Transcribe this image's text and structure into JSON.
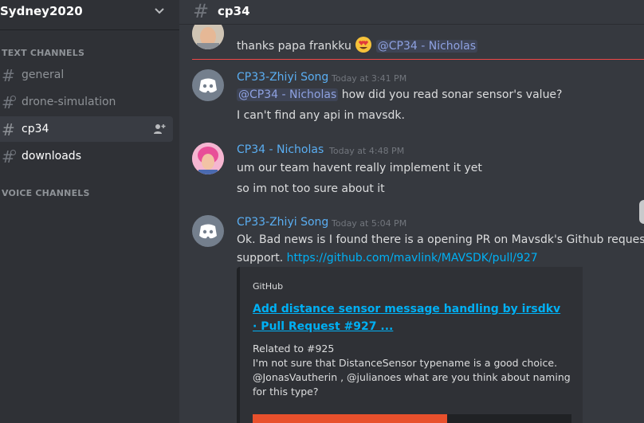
{
  "server": {
    "name": "Sydney2020"
  },
  "categories": {
    "text": "TEXT CHANNELS",
    "voice": "VOICE CHANNELS"
  },
  "channels": [
    {
      "name": "general"
    },
    {
      "name": "drone-simulation"
    },
    {
      "name": "cp34"
    },
    {
      "name": "downloads"
    }
  ],
  "topbar": {
    "channel": "cp34"
  },
  "messages": [
    {
      "text": "thanks papa frankku",
      "mention": "@CP34 - Nicholas"
    },
    {
      "author": "CP33-Zhiyi Song",
      "time": "Today at 3:41 PM",
      "mention": "@CP34 - Nicholas",
      "line1_rest": " how did you read sonar sensor's value?",
      "line2": "I can't find any api in mavsdk."
    },
    {
      "author": "CP34 - Nicholas",
      "time": "Today at 4:48 PM",
      "line1": "um our team havent really implement it yet",
      "line2": "so im not too sure about it"
    },
    {
      "author": "CP33-Zhiyi Song",
      "time": "Today at 5:04 PM",
      "line1": "Ok. Bad news is I found there is a opening PR on Mavsdk's Github requesting",
      "line2": "support.",
      "link": "https://github.com/mavlink/MAVSDK/pull/927"
    }
  ],
  "embed": {
    "provider": "GitHub",
    "title": "Add distance sensor message handling by irsdkv · Pull Request #927 ...",
    "description": "Related to #925\nI'm not sure that DistanceSensor typename is a good choice. @JonasVautherin , @julianoes what are you think about naming for this type?"
  },
  "colors": {
    "background": "#36393f",
    "sidebar": "#2f3136",
    "author": "#5aaef2",
    "link": "#00b0f4",
    "new_divider": "#f04747",
    "mav_orange": "#e8502c"
  }
}
